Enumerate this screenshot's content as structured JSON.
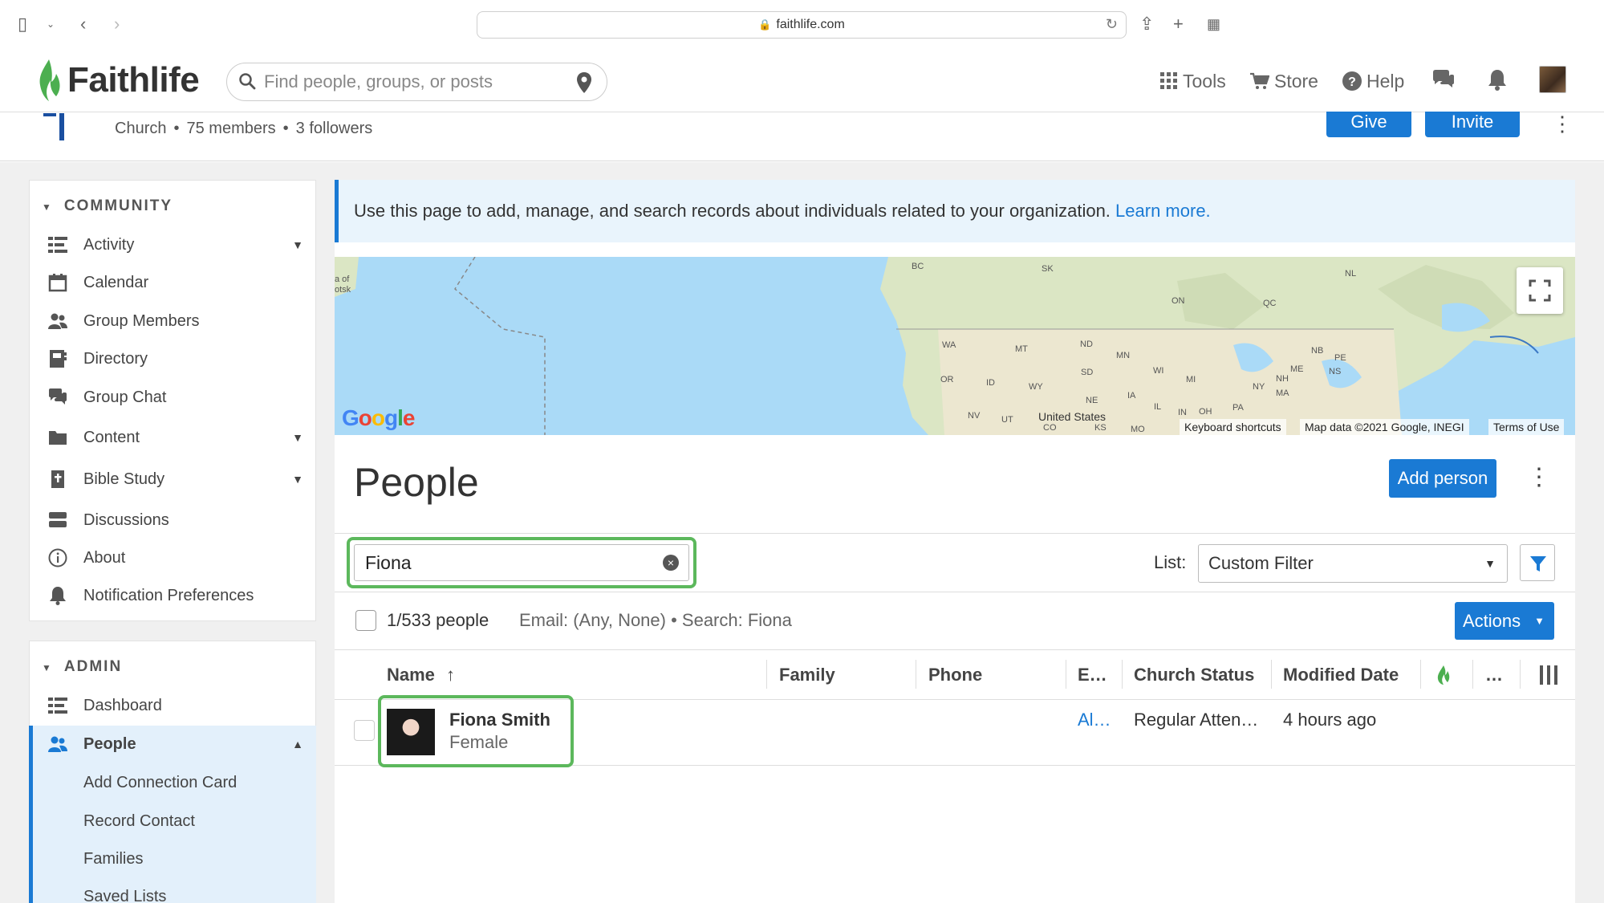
{
  "browser": {
    "url": "faithlife.com"
  },
  "header": {
    "brand": "Faithlife",
    "search_placeholder": "Find people, groups, or posts",
    "nav": {
      "tools": "Tools",
      "store": "Store",
      "help": "Help"
    }
  },
  "group": {
    "type": "Church",
    "members": "75 members",
    "followers": "3 followers",
    "give_label": "Give",
    "invite_label": "Invite"
  },
  "sidebar": {
    "community_title": "COMMUNITY",
    "community_items": [
      {
        "label": "Activity"
      },
      {
        "label": "Calendar"
      },
      {
        "label": "Group Members"
      },
      {
        "label": "Directory"
      },
      {
        "label": "Group Chat"
      },
      {
        "label": "Content"
      },
      {
        "label": "Bible Study"
      },
      {
        "label": "Discussions"
      },
      {
        "label": "About"
      },
      {
        "label": "Notification Preferences"
      }
    ],
    "admin_title": "ADMIN",
    "admin_items": [
      {
        "label": "Dashboard"
      },
      {
        "label": "People"
      }
    ],
    "people_sub_items": [
      {
        "label": "Add Connection Card"
      },
      {
        "label": "Record Contact"
      },
      {
        "label": "Families"
      },
      {
        "label": "Saved Lists"
      }
    ]
  },
  "main": {
    "banner_text": "Use this page to add, manage, and search records about individuals related to your organization.",
    "banner_link": "Learn more.",
    "map": {
      "labels": [
        "BC",
        "SK",
        "NL",
        "ON",
        "QC",
        "WA",
        "MT",
        "ND",
        "MN",
        "OR",
        "ID",
        "WY",
        "SD",
        "WI",
        "MI",
        "NE",
        "IA",
        "NY",
        "NH",
        "MA",
        "NV",
        "UT",
        "United States",
        "CO",
        "KS",
        "MO",
        "IL",
        "IN",
        "OH",
        "PA",
        "NB",
        "PE",
        "NS",
        "ME",
        "a of",
        "otsk"
      ],
      "google": "Google",
      "keyboard_shortcuts": "Keyboard shortcuts",
      "map_data": "Map data ©2021 Google, INEGI",
      "terms": "Terms of Use"
    },
    "title": "People",
    "add_person_label": "Add person",
    "search_value": "Fiona",
    "list_label": "List:",
    "list_value": "Custom Filter",
    "count_text": "1/533 people",
    "filter_desc": "Email: (Any, None) • Search: Fiona",
    "actions_label": "Actions",
    "columns": {
      "name": "Name",
      "family": "Family",
      "phone": "Phone",
      "email": "E…",
      "church_status": "Church Status",
      "modified_date": "Modified Date",
      "more": "…"
    },
    "rows": [
      {
        "name": "Fiona Smith",
        "gender": "Female",
        "email": "Al…",
        "church_status": "Regular Atten…",
        "modified_date": "4 hours ago"
      }
    ]
  },
  "colors": {
    "accent": "#1a7ad4",
    "highlight": "#5cb85c",
    "brand_green": "#4caf50"
  }
}
